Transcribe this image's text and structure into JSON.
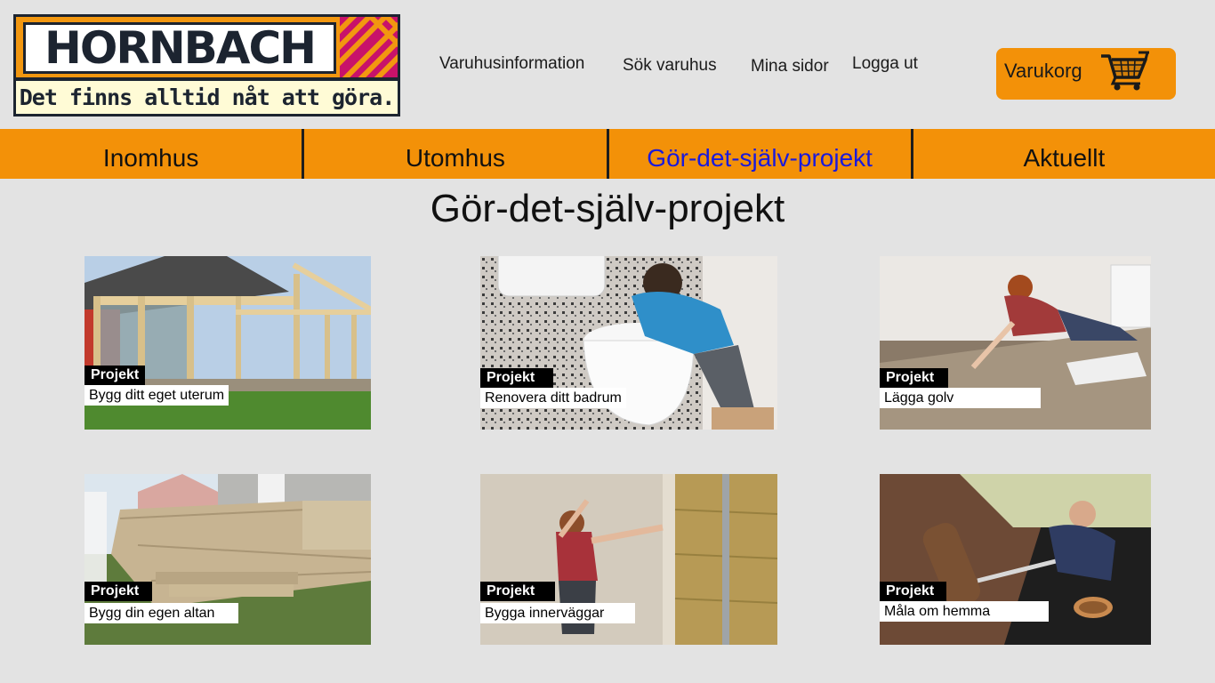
{
  "brand": {
    "name": "HORNBACH",
    "slogan": "Det finns alltid nåt att göra.",
    "colors": {
      "orange": "#f39108",
      "dark": "#1c2430",
      "magenta": "#c8126a"
    }
  },
  "header": {
    "links": [
      "Varuhusinformation",
      "Sök varuhus",
      "Mina sidor",
      "Logga ut"
    ],
    "cart": {
      "label": "Varukorg",
      "icon": "shopping-cart-icon"
    }
  },
  "nav": {
    "items": [
      "Inomhus",
      "Utomhus",
      "Gör-det-själv-projekt",
      "Aktuellt"
    ],
    "active_index": 2
  },
  "page": {
    "title": "Gör-det-själv-projekt"
  },
  "projects": [
    {
      "tag": "Projekt",
      "title": "Bygg ditt eget uterum"
    },
    {
      "tag": "Projekt",
      "title": "Renovera ditt badrum"
    },
    {
      "tag": "Projekt",
      "title": "Lägga golv"
    },
    {
      "tag": "Projekt",
      "title": "Bygg din egen altan"
    },
    {
      "tag": "Projekt",
      "title": "Bygga innerväggar"
    },
    {
      "tag": "Projekt",
      "title": "Måla om hemma"
    }
  ]
}
